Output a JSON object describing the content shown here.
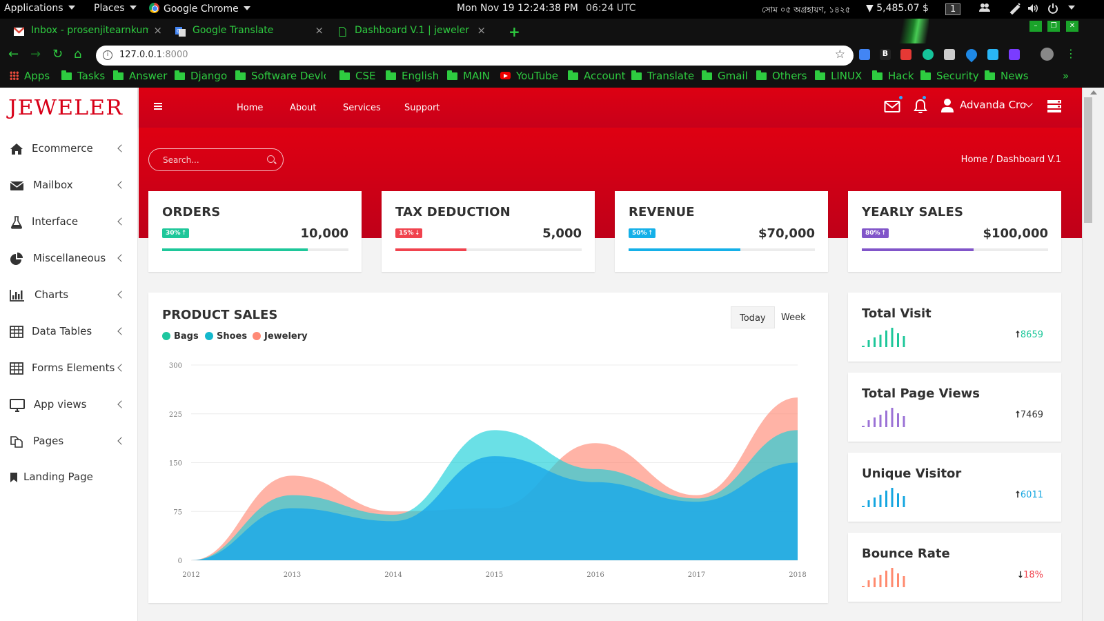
{
  "system_bar": {
    "applications": "Applications",
    "places": "Places",
    "browser": "Google Chrome",
    "datetime": "Mon Nov 19  12:24:38 PM",
    "utc": "06:24 UTC",
    "bengali_date": "সোম ০৫ অগ্রহায়ণ, ১৪২৫",
    "price": "▼ 5,485.07 $",
    "workspace": "1"
  },
  "browser": {
    "tabs": [
      {
        "title": "Inbox - prosenjitearnkuma",
        "icon": "gmail-icon"
      },
      {
        "title": "Google Translate",
        "icon": "translate-icon"
      },
      {
        "title": "Dashboard V.1 | jeweler - ",
        "icon": "page-icon"
      }
    ],
    "url_host": "127.0.0.1",
    "url_port": ":8000",
    "bookmarks": [
      "Apps",
      "Tasks",
      "Answer",
      "Django",
      "Software Devlop",
      "CSE",
      "English",
      "MAIN",
      "YouTube",
      "Account",
      "Translate",
      "Gmail",
      "Others",
      "LINUX",
      "Hack",
      "Security",
      "News"
    ],
    "more": "»"
  },
  "app": {
    "logo": "JEWELER",
    "colors": {
      "brand": "#d80018",
      "green": "#1ec79a",
      "red": "#f0434e",
      "blue": "#15b0e8",
      "purple": "#8155c9",
      "jewelery": "#ff8a76",
      "shoes": "#1ad0d8",
      "bags": "#0fb6c6"
    },
    "sidebar": [
      {
        "label": "Ecommerce",
        "icon": "home-icon"
      },
      {
        "label": "Mailbox",
        "icon": "envelope-icon"
      },
      {
        "label": "Interface",
        "icon": "flask-icon"
      },
      {
        "label": "Miscellaneous",
        "icon": "pie-chart-icon"
      },
      {
        "label": "Charts",
        "icon": "bar-chart-icon"
      },
      {
        "label": "Data Tables",
        "icon": "table-icon"
      },
      {
        "label": "Forms Elements",
        "icon": "form-table-icon"
      },
      {
        "label": "App views",
        "icon": "desktop-icon"
      },
      {
        "label": "Pages",
        "icon": "copy-icon"
      },
      {
        "label": "Landing Page",
        "icon": "bookmark-icon"
      }
    ],
    "topnav": [
      "Home",
      "About",
      "Services",
      "Support"
    ],
    "user": "Advanda Cro",
    "search_placeholder": "Search...",
    "breadcrumb": "Home / Dashboard V.1",
    "stats": [
      {
        "title": "ORDERS",
        "badge": "30% ⭡",
        "value": "10,000",
        "progress": 0.78
      },
      {
        "title": "TAX DEDUCTION",
        "badge": "15% ⭣",
        "value": "5,000",
        "progress": 0.38
      },
      {
        "title": "REVENUE",
        "badge": "50% ⭡",
        "value": "$70,000",
        "progress": 0.6
      },
      {
        "title": "YEARLY SALES",
        "badge": "80% ⭡",
        "value": "$100,000",
        "progress": 0.6
      }
    ],
    "product_sales": {
      "title": "PRODUCT SALES",
      "toggle": [
        "Today",
        "Week"
      ],
      "legend": [
        "Bags",
        "Shoes",
        "Jewelery"
      ]
    },
    "mini_stats": [
      {
        "title": "Total Visit",
        "arrow": "⭡",
        "value": "8659",
        "trend": "up"
      },
      {
        "title": "Total Page Views",
        "arrow": "⭡",
        "value": "7469",
        "trend": "up"
      },
      {
        "title": "Unique Visitor",
        "arrow": "⭡",
        "value": "6011",
        "trend": "up"
      },
      {
        "title": "Bounce Rate",
        "arrow": "⭣",
        "value": "18%",
        "trend": "down"
      }
    ]
  },
  "chart_data": {
    "type": "area",
    "x": [
      "2012",
      "2013",
      "2014",
      "2015",
      "2016",
      "2017",
      "2018"
    ],
    "yticks": [
      0,
      75,
      150,
      225,
      300
    ],
    "ylim": [
      0,
      300
    ],
    "series": [
      {
        "name": "Bags",
        "values": [
          0,
          80,
          60,
          160,
          120,
          90,
          150
        ]
      },
      {
        "name": "Shoes",
        "values": [
          0,
          100,
          70,
          200,
          140,
          95,
          200
        ]
      },
      {
        "name": "Jewelery",
        "values": [
          0,
          130,
          75,
          80,
          180,
          100,
          250
        ]
      }
    ]
  }
}
